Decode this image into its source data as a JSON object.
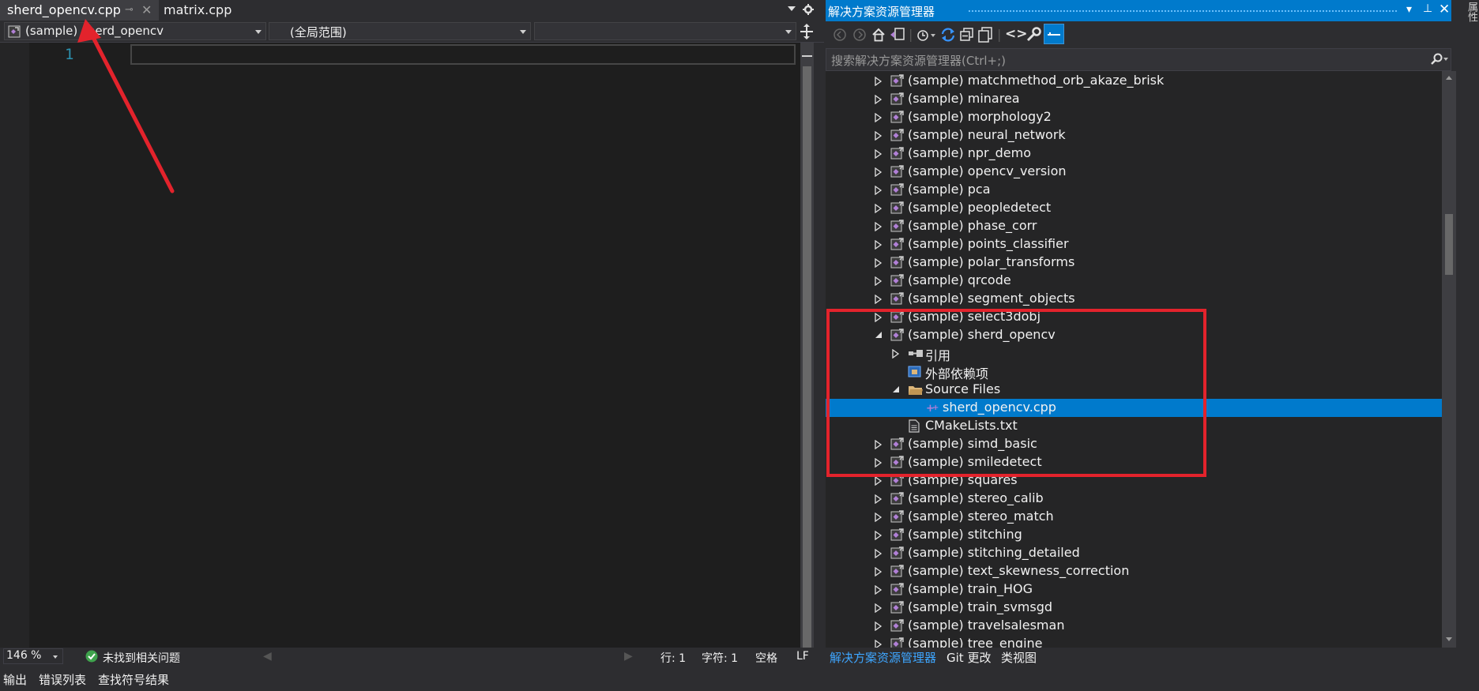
{
  "editor": {
    "tabs": {
      "active": "sherd_opencv.cpp",
      "second": "matrix.cpp"
    },
    "nav": {
      "project": "(sample) sherd_opencv",
      "scope": "(全局范围)",
      "member": ""
    },
    "line_numbers": [
      "1"
    ],
    "status": {
      "zoom": "146 %",
      "issues": "未找到相关问题",
      "line": "行: 1",
      "char": "字符: 1",
      "spaces": "空格",
      "eol": "LF"
    }
  },
  "bottom_tabs": [
    "输出",
    "错误列表",
    "查找符号结果"
  ],
  "side_tab": "属性",
  "solution_explorer": {
    "title": "解决方案资源管理器",
    "search_placeholder": "搜索解决方案资源管理器(Ctrl+;)",
    "tree": [
      {
        "label": "(sample) matchmethod_orb_akaze_brisk",
        "type": "project",
        "expanded": false,
        "level": 0
      },
      {
        "label": "(sample) minarea",
        "type": "project",
        "expanded": false,
        "level": 0
      },
      {
        "label": "(sample) morphology2",
        "type": "project",
        "expanded": false,
        "level": 0
      },
      {
        "label": "(sample) neural_network",
        "type": "project",
        "expanded": false,
        "level": 0
      },
      {
        "label": "(sample) npr_demo",
        "type": "project",
        "expanded": false,
        "level": 0
      },
      {
        "label": "(sample) opencv_version",
        "type": "project",
        "expanded": false,
        "level": 0
      },
      {
        "label": "(sample) pca",
        "type": "project",
        "expanded": false,
        "level": 0
      },
      {
        "label": "(sample) peopledetect",
        "type": "project",
        "expanded": false,
        "level": 0
      },
      {
        "label": "(sample) phase_corr",
        "type": "project",
        "expanded": false,
        "level": 0
      },
      {
        "label": "(sample) points_classifier",
        "type": "project",
        "expanded": false,
        "level": 0
      },
      {
        "label": "(sample) polar_transforms",
        "type": "project",
        "expanded": false,
        "level": 0
      },
      {
        "label": "(sample) qrcode",
        "type": "project",
        "expanded": false,
        "level": 0
      },
      {
        "label": "(sample) segment_objects",
        "type": "project",
        "expanded": false,
        "level": 0
      },
      {
        "label": "(sample) select3dobj",
        "type": "project",
        "expanded": false,
        "level": 0
      },
      {
        "label": "(sample) sherd_opencv",
        "type": "project",
        "expanded": true,
        "level": 0
      },
      {
        "label": "引用",
        "type": "references",
        "expanded": false,
        "level": 1
      },
      {
        "label": "外部依赖项",
        "type": "external",
        "level": 1
      },
      {
        "label": "Source Files",
        "type": "folder",
        "expanded": true,
        "level": 1
      },
      {
        "label": "sherd_opencv.cpp",
        "type": "cpp",
        "level": 2,
        "selected": true
      },
      {
        "label": "CMakeLists.txt",
        "type": "txt",
        "level": 1
      },
      {
        "label": "(sample) simd_basic",
        "type": "project",
        "expanded": false,
        "level": 0
      },
      {
        "label": "(sample) smiledetect",
        "type": "project",
        "expanded": false,
        "level": 0
      },
      {
        "label": "(sample) squares",
        "type": "project",
        "expanded": false,
        "level": 0
      },
      {
        "label": "(sample) stereo_calib",
        "type": "project",
        "expanded": false,
        "level": 0
      },
      {
        "label": "(sample) stereo_match",
        "type": "project",
        "expanded": false,
        "level": 0
      },
      {
        "label": "(sample) stitching",
        "type": "project",
        "expanded": false,
        "level": 0
      },
      {
        "label": "(sample) stitching_detailed",
        "type": "project",
        "expanded": false,
        "level": 0
      },
      {
        "label": "(sample) text_skewness_correction",
        "type": "project",
        "expanded": false,
        "level": 0
      },
      {
        "label": "(sample) train_HOG",
        "type": "project",
        "expanded": false,
        "level": 0
      },
      {
        "label": "(sample) train_svmsgd",
        "type": "project",
        "expanded": false,
        "level": 0
      },
      {
        "label": "(sample) travelsalesman",
        "type": "project",
        "expanded": false,
        "level": 0
      },
      {
        "label": "(sample) tree_engine",
        "type": "project",
        "expanded": false,
        "level": 0
      }
    ],
    "tabs": [
      "解决方案资源管理器",
      "Git 更改",
      "类视图"
    ]
  },
  "colors": {
    "accent": "#007acc",
    "annotation": "#e3232c",
    "line_number": "#2b91af",
    "project_icon": "#b180d7"
  }
}
